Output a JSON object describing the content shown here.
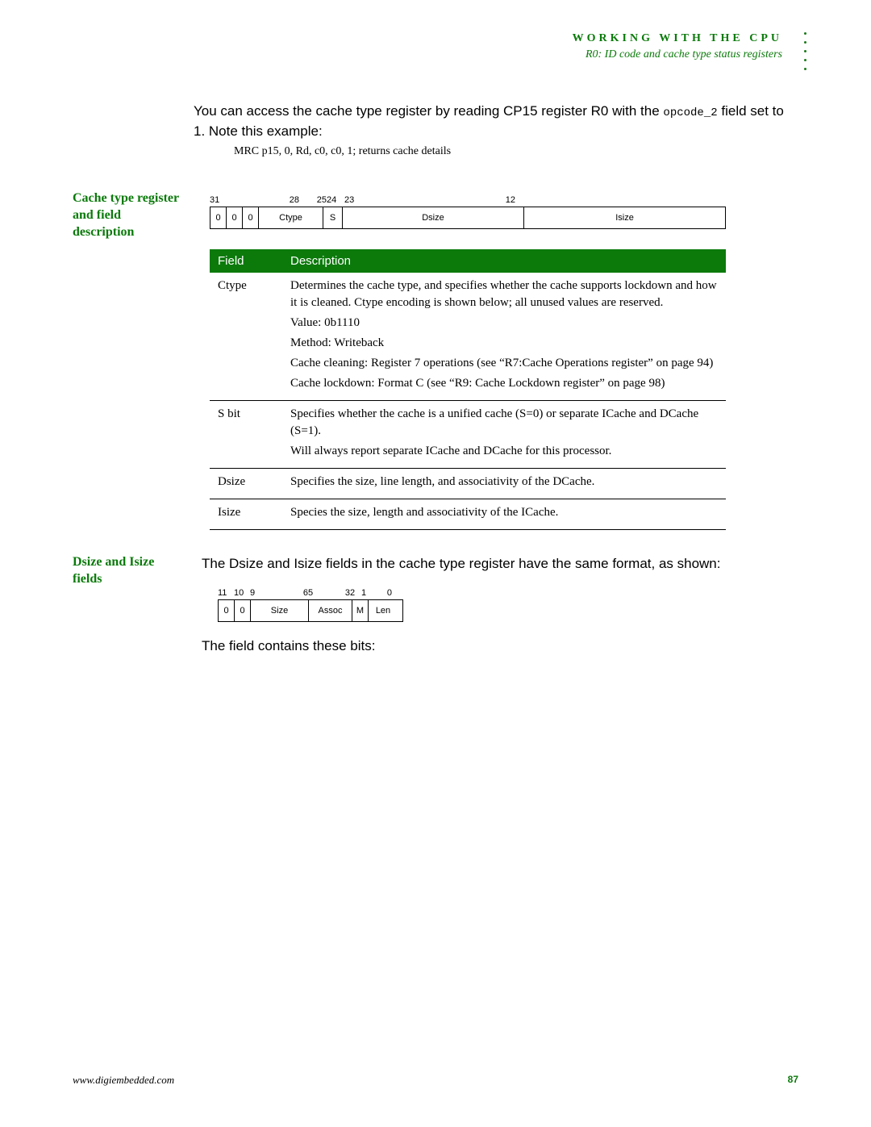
{
  "header": {
    "chapter": "WORKING WITH THE CPU",
    "sub": "R0: ID code and cache type status registers"
  },
  "intro": {
    "para1a": "You can access the cache type register by reading CP15 register R0 with the ",
    "opcode": "opcode_2",
    "para1b": " field set to 1. Note this example:",
    "code": "MRC p15, 0, Rd, c0, c0, 1; returns cache details"
  },
  "section1": {
    "heading": "Cache type register and field description",
    "bitlabels": {
      "l31": "31",
      "l28": "28",
      "l25": "25",
      "l24": "24",
      "l23": "23",
      "l12": "12"
    },
    "bits": {
      "c0a": "0",
      "c0b": "0",
      "c0c": "0",
      "ctype": "Ctype",
      "s": "S",
      "dsize": "Dsize",
      "isize": "Isize"
    },
    "table": {
      "headers": {
        "field": "Field",
        "desc": "Description"
      },
      "rows": [
        {
          "field": "Ctype",
          "lines": [
            "Determines the cache type, and specifies whether the cache supports lockdown and how it is cleaned. Ctype encoding is shown below; all unused values are reserved.",
            "Value: 0b1110",
            "Method: Writeback",
            "Cache cleaning: Register 7 operations (see “R7:Cache Operations register” on page 94)",
            "Cache lockdown: Format C (see “R9: Cache Lockdown register” on page 98)"
          ]
        },
        {
          "field": "S bit",
          "lines": [
            "Specifies whether the cache is a unified cache (S=0) or separate ICache and DCache (S=1).",
            "Will always report separate ICache and DCache for this processor."
          ]
        },
        {
          "field": "Dsize",
          "lines": [
            "Specifies the size, line length, and associativity of the DCache."
          ]
        },
        {
          "field": "Isize",
          "lines": [
            "Species the size, length and associativity of the ICache."
          ]
        }
      ]
    }
  },
  "section2": {
    "heading": "Dsize and Isize fields",
    "para": "The Dsize and Isize fields in the cache type register have the same format, as shown:",
    "bitlabels": {
      "l11": "11",
      "l10": "10",
      "l9": "9",
      "l6": "6",
      "l5": "5",
      "l3": "3",
      "l2": "2",
      "l1": "1",
      "l0": "0"
    },
    "bits": {
      "c0a": "0",
      "c0b": "0",
      "size": "Size",
      "assoc": "Assoc",
      "m": "M",
      "len": "Len"
    },
    "para2": "The field contains these bits:"
  },
  "footer": {
    "url": "www.digiembedded.com",
    "page": "87"
  }
}
